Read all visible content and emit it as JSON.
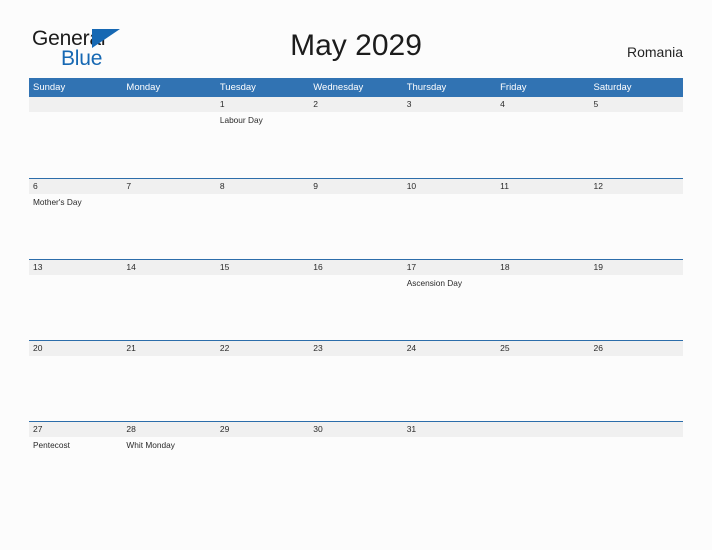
{
  "header": {
    "logo": {
      "word1": "General",
      "word2": "Blue",
      "flag_icon": "triangle-flag-icon",
      "color_dark": "#1b1b1b",
      "color_blue": "#1668b3"
    },
    "title": "May 2029",
    "country": "Romania"
  },
  "calendar": {
    "accent_color": "#3173b3",
    "band_color": "#f0f0f0",
    "weekdays": [
      "Sunday",
      "Monday",
      "Tuesday",
      "Wednesday",
      "Thursday",
      "Friday",
      "Saturday"
    ],
    "weeks": [
      [
        {
          "date": "",
          "event": ""
        },
        {
          "date": "",
          "event": ""
        },
        {
          "date": "1",
          "event": "Labour Day"
        },
        {
          "date": "2",
          "event": ""
        },
        {
          "date": "3",
          "event": ""
        },
        {
          "date": "4",
          "event": ""
        },
        {
          "date": "5",
          "event": ""
        }
      ],
      [
        {
          "date": "6",
          "event": "Mother's Day"
        },
        {
          "date": "7",
          "event": ""
        },
        {
          "date": "8",
          "event": ""
        },
        {
          "date": "9",
          "event": ""
        },
        {
          "date": "10",
          "event": ""
        },
        {
          "date": "11",
          "event": ""
        },
        {
          "date": "12",
          "event": ""
        }
      ],
      [
        {
          "date": "13",
          "event": ""
        },
        {
          "date": "14",
          "event": ""
        },
        {
          "date": "15",
          "event": ""
        },
        {
          "date": "16",
          "event": ""
        },
        {
          "date": "17",
          "event": "Ascension Day"
        },
        {
          "date": "18",
          "event": ""
        },
        {
          "date": "19",
          "event": ""
        }
      ],
      [
        {
          "date": "20",
          "event": ""
        },
        {
          "date": "21",
          "event": ""
        },
        {
          "date": "22",
          "event": ""
        },
        {
          "date": "23",
          "event": ""
        },
        {
          "date": "24",
          "event": ""
        },
        {
          "date": "25",
          "event": ""
        },
        {
          "date": "26",
          "event": ""
        }
      ],
      [
        {
          "date": "27",
          "event": "Pentecost"
        },
        {
          "date": "28",
          "event": "Whit Monday"
        },
        {
          "date": "29",
          "event": ""
        },
        {
          "date": "30",
          "event": ""
        },
        {
          "date": "31",
          "event": ""
        },
        {
          "date": "",
          "event": ""
        },
        {
          "date": "",
          "event": ""
        }
      ]
    ]
  }
}
